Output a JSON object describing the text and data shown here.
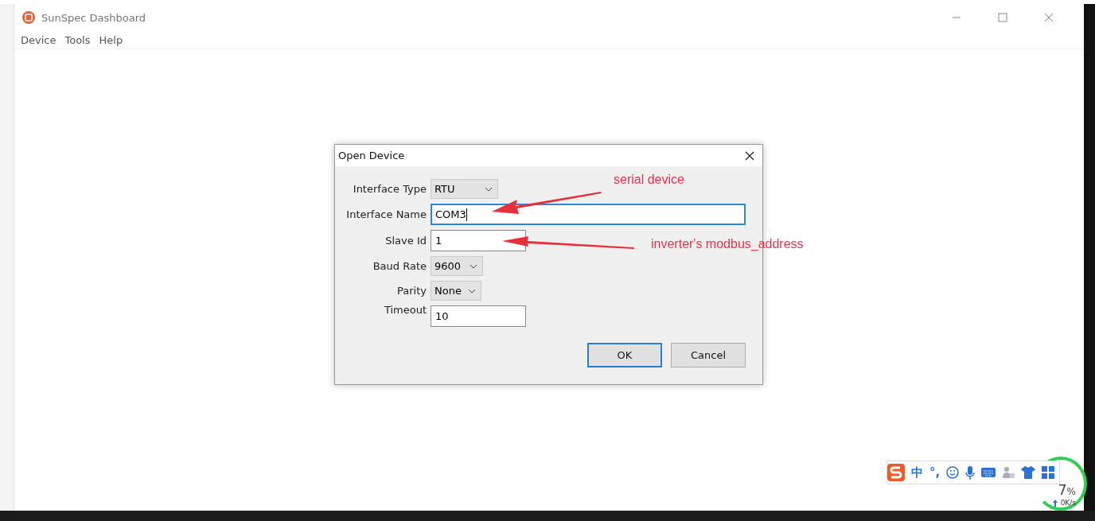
{
  "window": {
    "title": "SunSpec Dashboard"
  },
  "menu": [
    {
      "label": "Device"
    },
    {
      "label": "Tools"
    },
    {
      "label": "Help"
    }
  ],
  "dialog": {
    "title": "Open Device",
    "fields": [
      {
        "kind": "select",
        "label": "Interface Type",
        "value": "RTU"
      },
      {
        "kind": "input",
        "label": "Interface Name",
        "value": "COM3",
        "focused": true
      },
      {
        "kind": "input",
        "label": "Slave Id",
        "value": "1",
        "focused": false
      },
      {
        "kind": "select",
        "label": "Baud Rate",
        "value": "9600"
      },
      {
        "kind": "select",
        "label": "Parity",
        "value": "None"
      },
      {
        "kind": "input",
        "label": "Timeout",
        "value": "10",
        "focused": false
      }
    ],
    "buttons": [
      {
        "label": "OK",
        "default": true
      },
      {
        "label": "Cancel",
        "default": false
      }
    ]
  },
  "annotations": [
    {
      "text": "serial device"
    },
    {
      "text": "inverter's modbus_address"
    }
  ],
  "ime_toolbar": {
    "mode": "中",
    "punctuation": "°,"
  },
  "net_widget": {
    "value": "7",
    "unit": "%",
    "speed": "0K/s"
  }
}
